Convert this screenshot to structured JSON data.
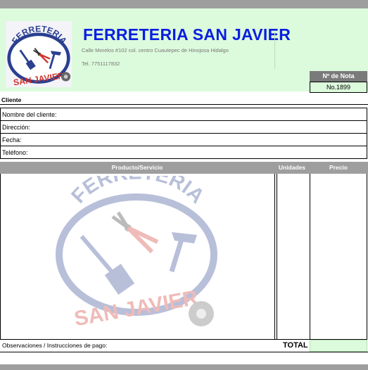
{
  "header": {
    "title": "FERRETERIA SAN JAVIER",
    "address": "Calle Morelos #102 col. centro Cuautepec de Hinojosa Hidalgo",
    "phone": "Tel. 7751117832",
    "logo": {
      "top_text": "FERRETERIA",
      "bottom_text": "SAN JAVIER",
      "icons": [
        "shovel-icon",
        "pliers-icon",
        "hammer-icon",
        "pipe-icon"
      ]
    }
  },
  "nota": {
    "label": "Nº de Nota",
    "value": "No.1899"
  },
  "client": {
    "section_title": "Cliente",
    "fields": [
      "Nombre del cliente:",
      "Dirección:",
      "Fecha:",
      "Teléfono:"
    ]
  },
  "table": {
    "columns": [
      "Producto/Servicio",
      "Unidades",
      "Precio"
    ]
  },
  "footer": {
    "observations": "Observaciones / Instrucciones de pago:",
    "total_label": "TOTAL",
    "total_value": ""
  },
  "colors": {
    "header_bg": "#dcfadc",
    "title_blue": "#0a1ee0",
    "bar_gray": "#9e9e9e",
    "nota_gray": "#7a7a7a"
  }
}
